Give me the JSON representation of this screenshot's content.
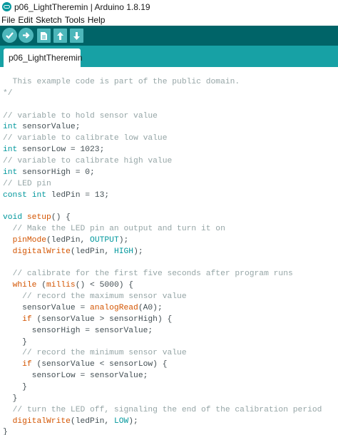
{
  "window": {
    "title": "p06_LightTheremin | Arduino 1.8.19"
  },
  "menu": [
    "File",
    "Edit",
    "Sketch",
    "Tools",
    "Help"
  ],
  "toolbar": {
    "buttons": [
      "verify",
      "upload",
      "new",
      "open",
      "save"
    ]
  },
  "tabs": [
    {
      "label": "p06_LightTheremin"
    }
  ],
  "colors": {
    "toolbar": "#006468",
    "tabbar": "#17a1a5",
    "button": "#4db7bb",
    "comment": "#95a5a6",
    "keyword": "#00979c",
    "function": "#d35400",
    "text": "#434f54"
  },
  "code": [
    [
      {
        "t": "  This example code is part of the public domain.",
        "c": "comment"
      }
    ],
    [
      {
        "t": "*/",
        "c": "comment"
      }
    ],
    [],
    [
      {
        "t": "// variable to hold sensor value",
        "c": "comment"
      }
    ],
    [
      {
        "t": "int",
        "c": "type"
      },
      {
        "t": " sensorValue;"
      }
    ],
    [
      {
        "t": "// variable to calibrate low value",
        "c": "comment"
      }
    ],
    [
      {
        "t": "int",
        "c": "type"
      },
      {
        "t": " sensorLow = 1023;"
      }
    ],
    [
      {
        "t": "// variable to calibrate high value",
        "c": "comment"
      }
    ],
    [
      {
        "t": "int",
        "c": "type"
      },
      {
        "t": " sensorHigh = 0;"
      }
    ],
    [
      {
        "t": "// LED pin",
        "c": "comment"
      }
    ],
    [
      {
        "t": "const",
        "c": "type"
      },
      {
        "t": " "
      },
      {
        "t": "int",
        "c": "type"
      },
      {
        "t": " ledPin = 13;"
      }
    ],
    [],
    [
      {
        "t": "void",
        "c": "type"
      },
      {
        "t": " "
      },
      {
        "t": "setup",
        "c": "func"
      },
      {
        "t": "() {"
      }
    ],
    [
      {
        "t": "  "
      },
      {
        "t": "// Make the LED pin an output and turn it on",
        "c": "comment"
      }
    ],
    [
      {
        "t": "  "
      },
      {
        "t": "pinMode",
        "c": "func"
      },
      {
        "t": "(ledPin, "
      },
      {
        "t": "OUTPUT",
        "c": "const"
      },
      {
        "t": ");"
      }
    ],
    [
      {
        "t": "  "
      },
      {
        "t": "digitalWrite",
        "c": "func"
      },
      {
        "t": "(ledPin, "
      },
      {
        "t": "HIGH",
        "c": "const"
      },
      {
        "t": ");"
      }
    ],
    [],
    [
      {
        "t": "  "
      },
      {
        "t": "// calibrate for the first five seconds after program runs",
        "c": "comment"
      }
    ],
    [
      {
        "t": "  "
      },
      {
        "t": "while",
        "c": "func"
      },
      {
        "t": " ("
      },
      {
        "t": "millis",
        "c": "func"
      },
      {
        "t": "() < 5000) {"
      }
    ],
    [
      {
        "t": "    "
      },
      {
        "t": "// record the maximum sensor value",
        "c": "comment"
      }
    ],
    [
      {
        "t": "    sensorValue = "
      },
      {
        "t": "analogRead",
        "c": "func"
      },
      {
        "t": "(A0);"
      }
    ],
    [
      {
        "t": "    "
      },
      {
        "t": "if",
        "c": "func"
      },
      {
        "t": " (sensorValue > sensorHigh) {"
      }
    ],
    [
      {
        "t": "      sensorHigh = sensorValue;"
      }
    ],
    [
      {
        "t": "    }"
      }
    ],
    [
      {
        "t": "    "
      },
      {
        "t": "// record the minimum sensor value",
        "c": "comment"
      }
    ],
    [
      {
        "t": "    "
      },
      {
        "t": "if",
        "c": "func"
      },
      {
        "t": " (sensorValue < sensorLow) {"
      }
    ],
    [
      {
        "t": "      sensorLow = sensorValue;"
      }
    ],
    [
      {
        "t": "    }"
      }
    ],
    [
      {
        "t": "  }"
      }
    ],
    [
      {
        "t": "  "
      },
      {
        "t": "// turn the LED off, signaling the end of the calibration period",
        "c": "comment"
      }
    ],
    [
      {
        "t": "  "
      },
      {
        "t": "digitalWrite",
        "c": "func"
      },
      {
        "t": "(ledPin, "
      },
      {
        "t": "LOW",
        "c": "const"
      },
      {
        "t": ");"
      }
    ],
    [
      {
        "t": "}"
      }
    ]
  ]
}
